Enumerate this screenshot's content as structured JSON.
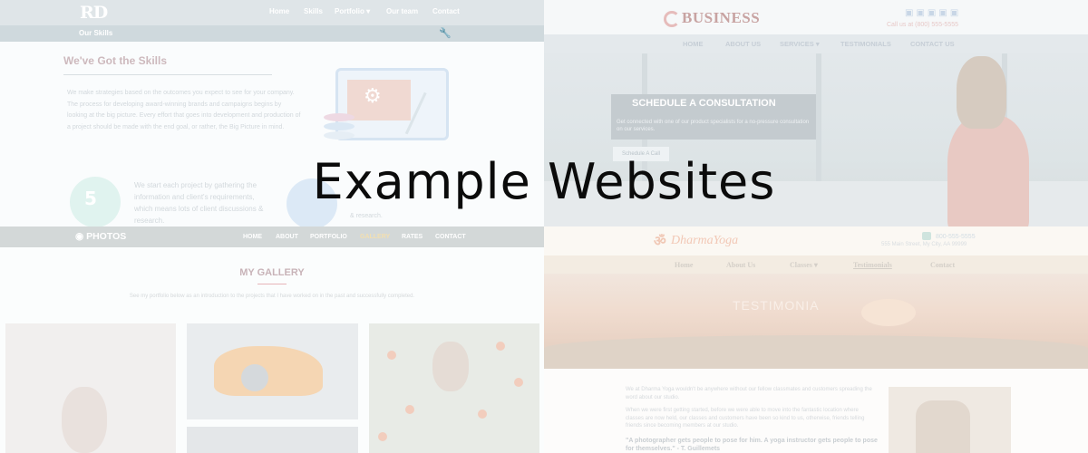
{
  "title": "Example Websites",
  "colors": {
    "overlay_text": "#0b0b0b",
    "page_bg": "#ffffff"
  },
  "site_rd": {
    "logo": "RD",
    "nav": [
      "Home",
      "Skills",
      "Portfolio ▾",
      "Our team",
      "Contact"
    ],
    "subheader": "Our Skills",
    "subheader_icon": "wrench-icon",
    "heading": "We've Got the Skills",
    "paragraph": "We make strategies based on the outcomes you expect to see for your company. The process for developing award-winning brands and campaigns begins by looking at the big picture. Every effort that goes into development and production of a project should be made with the end goal, or rather, the Big Picture in mind.",
    "feature_icon": "html5-icon",
    "feature_label": "5",
    "feature_text": "We start each project by gathering the information and client's requirements, which means lots of client discussions & research.",
    "fragment": "& research."
  },
  "site_business": {
    "logo": "BUSINESS",
    "social_icons": [
      "facebook-icon",
      "twitter-icon",
      "instagram-icon",
      "youtube-icon",
      "linkedin-icon"
    ],
    "call_line": "Call us at (800) 555-5555",
    "nav": [
      "HOME",
      "ABOUT US",
      "SERVICES ▾",
      "TESTIMONIALS",
      "CONTACT US"
    ],
    "cta_title": "SCHEDULE A CONSULTATION",
    "cta_text": "Get connected with one of our product specialists for a no-pressure consultation on our services.",
    "cta_button": "Schedule A Call"
  },
  "site_photos": {
    "logo": "PHOTOS",
    "nav": [
      "HOME",
      "ABOUT",
      "PORTFOLIO",
      "GALLERY",
      "RATES",
      "CONTACT"
    ],
    "heading": "MY GALLERY",
    "subtext": "See my portfolio below as an introduction to the projects that I have worked on in the past and successfully completed."
  },
  "site_yoga": {
    "logo_symbol": "ॐ",
    "logo": "DharmaYoga",
    "phone": "800-555-5555",
    "address": "555 Main Street, My City, AA 99999",
    "nav": [
      "Home",
      "About Us",
      "Classes ▾",
      "Testimonials",
      "Contact"
    ],
    "hero_title": "TESTIMONIA",
    "body_1": "We at Dharma Yoga wouldn't be anywhere without our fellow classmates and customers spreading the word about our studio.",
    "body_2": "When we were first getting started, before we were able to move into the fantastic location where classes are now held, our classes and customers have been so kind to us, otherwise, friends telling friends since becoming members at our studio.",
    "quote": "\"A photographer gets people to pose for him. A yoga instructor gets people to pose for themselves.\" - T. Guillemets"
  }
}
